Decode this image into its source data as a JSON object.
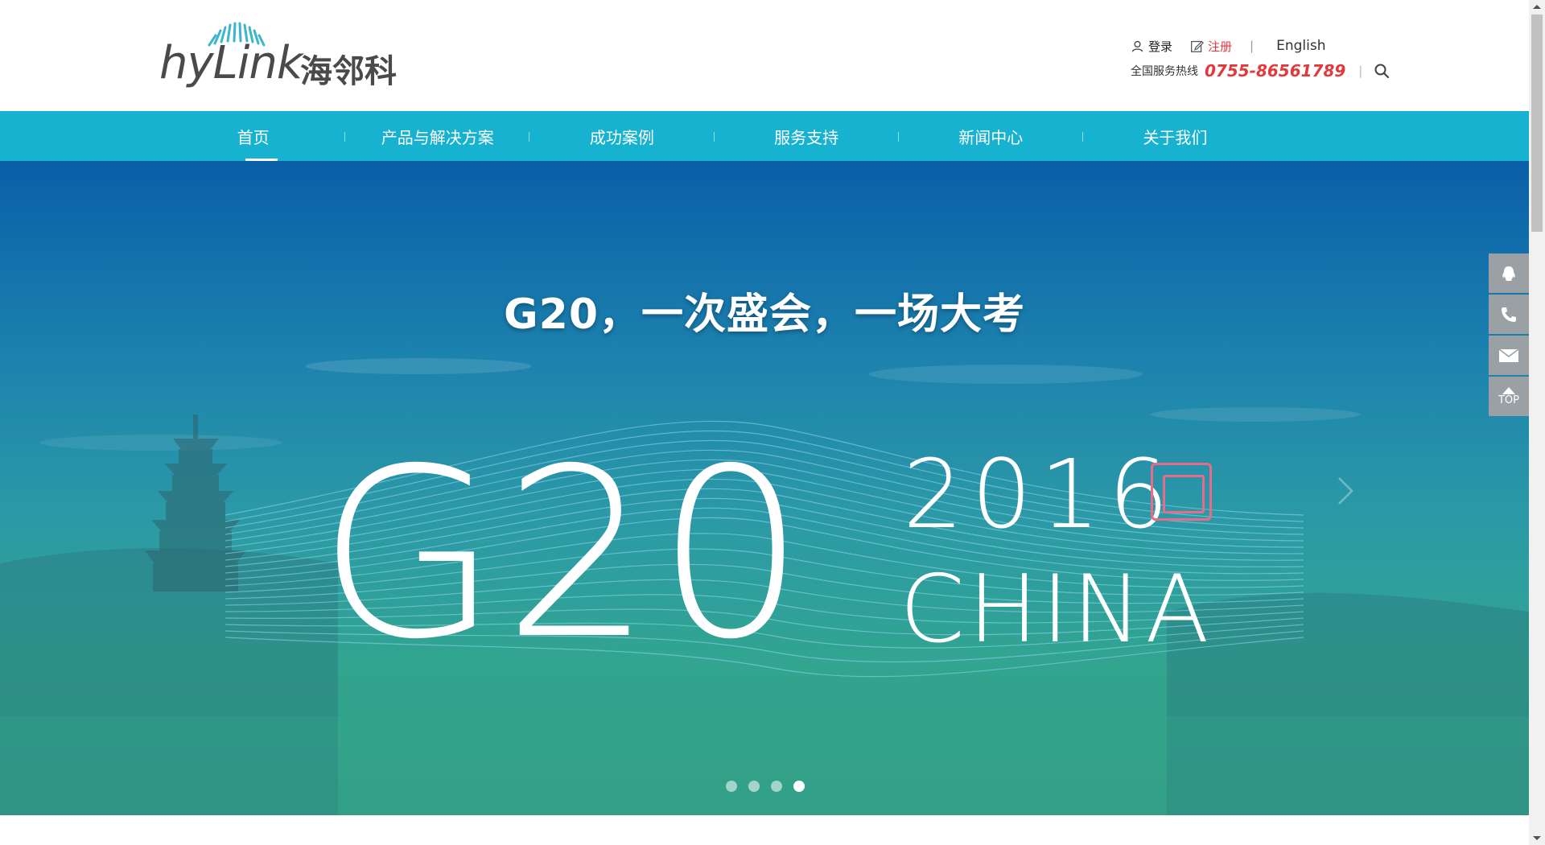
{
  "header": {
    "logo_text": "hyLink",
    "logo_cn": "海邻科",
    "login_label": "登录",
    "register_label": "注册",
    "separator": "|",
    "english_label": "English",
    "hotline_label": "全国服务热线",
    "hotline_number": "0755-86561789",
    "accent_color": "#e4393c"
  },
  "nav": {
    "items": [
      {
        "label": "首页"
      },
      {
        "label": "产品与解决方案"
      },
      {
        "label": "成功案例"
      },
      {
        "label": "服务支持"
      },
      {
        "label": "新闻中心"
      },
      {
        "label": "关于我们"
      }
    ],
    "active_index": 0,
    "bg_color": "#17b2cf"
  },
  "banner": {
    "title": "G20，一次盛会，一场大考",
    "g20": "G20",
    "year": "2016",
    "china": "CHINA",
    "slide_count": 4,
    "active_slide": 4
  },
  "floatbar": {
    "items": [
      "qq-icon",
      "phone-icon",
      "mail-icon",
      "back-to-top"
    ],
    "top_label": "TOP"
  }
}
